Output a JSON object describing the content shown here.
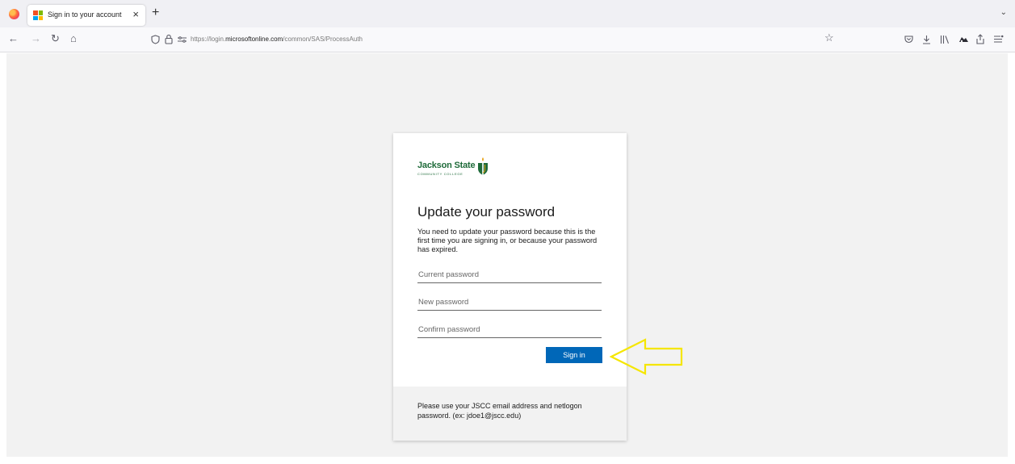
{
  "browser": {
    "tab_title": "Sign in to your account",
    "tab_close": "×",
    "new_tab": "+",
    "tab_list": "⌄",
    "url_prefix": "https://login.",
    "url_domain": "microsoftonline.com",
    "url_path": "/common/SAS/ProcessAuth",
    "icons": [
      "firefox-logo",
      "microsoft-logo",
      "back-icon",
      "forward-icon",
      "reload-icon",
      "home-icon",
      "shield-icon",
      "lock-icon",
      "permissions-icon",
      "bookmark-star-icon",
      "pocket-icon",
      "download-icon",
      "library-icon",
      "extension-icon",
      "share-icon",
      "menu-icon"
    ]
  },
  "logo": {
    "main": "Jackson State",
    "sub": "COMMUNITY COLLEGE",
    "colors": {
      "green": "#1f6b3a",
      "gold": "#e8a317"
    }
  },
  "form": {
    "title": "Update your password",
    "description": "You need to update your password because this is the first time you are signing in, or because your password has expired.",
    "current_password_placeholder": "Current password",
    "new_password_placeholder": "New password",
    "confirm_password_placeholder": "Confirm password",
    "sign_in_label": "Sign in"
  },
  "footer": {
    "text": "Please use your JSCC email address and netlogon password. (ex: jdoe1@jscc.edu)"
  },
  "colors": {
    "accent": "#0067b8",
    "annotation_arrow": "#f5e600",
    "page_background": "#f2f2f2"
  }
}
